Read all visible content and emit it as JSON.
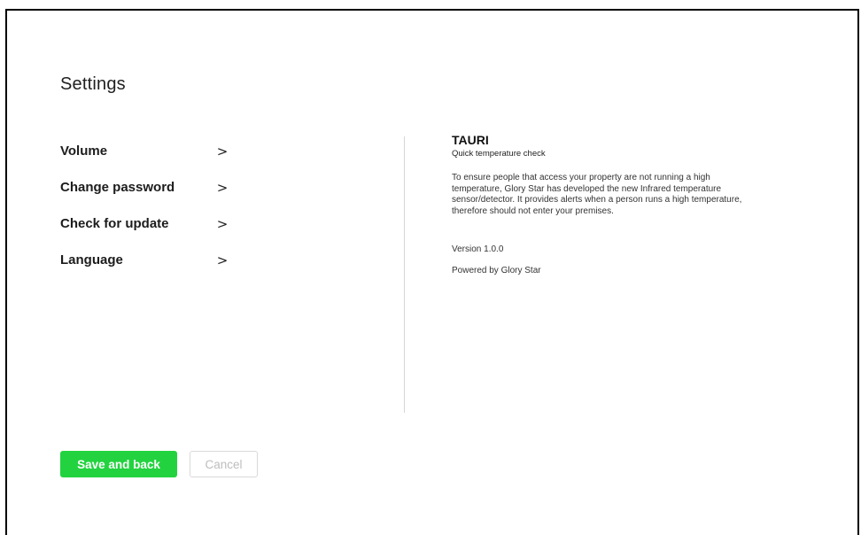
{
  "header": {
    "title": "Settings"
  },
  "menu": {
    "items": [
      {
        "label": "Volume",
        "chevron": ">"
      },
      {
        "label": "Change password",
        "chevron": ">"
      },
      {
        "label": "Check for update",
        "chevron": ">"
      },
      {
        "label": "Language",
        "chevron": ">"
      }
    ]
  },
  "info": {
    "product_name": "TAURI",
    "subtitle": "Quick temperature check",
    "description": "To ensure people that access your property are not running a high temperature, Glory Star has developed the new Infrared temperature sensor/detector. It provides alerts when a person runs a high temperature, therefore should not enter your premises.",
    "version": "Version 1.0.0",
    "powered_by": "Powered by Glory Star"
  },
  "actions": {
    "save_label": "Save and back",
    "cancel_label": "Cancel"
  },
  "colors": {
    "primary": "#22d33f",
    "cancel_text": "#bdbdbd",
    "divider": "#d6d6d6"
  }
}
